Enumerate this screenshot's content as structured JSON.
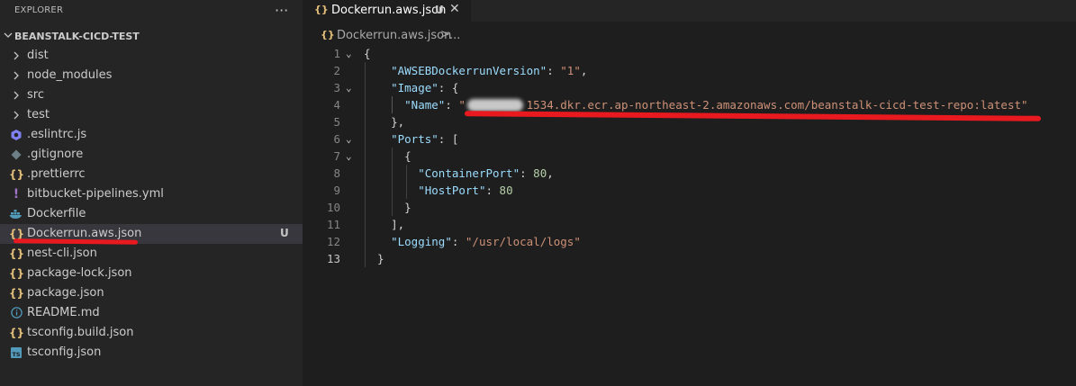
{
  "sidebar": {
    "title": "EXPLORER",
    "more": "···",
    "folder": "BEANSTALK-CICD-TEST",
    "items": [
      {
        "label": "dist",
        "type": "folder",
        "icon": "chevron-right-icon"
      },
      {
        "label": "node_modules",
        "type": "folder",
        "icon": "chevron-right-icon"
      },
      {
        "label": "src",
        "type": "folder",
        "icon": "chevron-right-icon"
      },
      {
        "label": "test",
        "type": "folder",
        "icon": "chevron-right-icon"
      },
      {
        "label": ".eslintrc.js",
        "type": "file",
        "icon": "eslint-icon"
      },
      {
        "label": ".gitignore",
        "type": "file",
        "icon": "git-icon"
      },
      {
        "label": ".prettierrc",
        "type": "file",
        "icon": "json-icon"
      },
      {
        "label": "bitbucket-pipelines.yml",
        "type": "file",
        "icon": "yaml-icon"
      },
      {
        "label": "Dockerfile",
        "type": "file",
        "icon": "docker-icon"
      },
      {
        "label": "Dockerrun.aws.json",
        "type": "file",
        "icon": "json-icon",
        "badge": "U"
      },
      {
        "label": "nest-cli.json",
        "type": "file",
        "icon": "json-icon"
      },
      {
        "label": "package-lock.json",
        "type": "file",
        "icon": "json-icon"
      },
      {
        "label": "package.json",
        "type": "file",
        "icon": "json-icon"
      },
      {
        "label": "README.md",
        "type": "file",
        "icon": "info-icon"
      },
      {
        "label": "tsconfig.build.json",
        "type": "file",
        "icon": "json-icon"
      },
      {
        "label": "tsconfig.json",
        "type": "file",
        "icon": "typescript-icon"
      }
    ]
  },
  "tab": {
    "icon": "{}",
    "label": "Dockerrun.aws.json",
    "status": "U",
    "close": "✕"
  },
  "breadcrumb": {
    "icon": "{}",
    "file": "Dockerrun.aws.json",
    "sep": ">",
    "more": "..."
  },
  "editor": {
    "lines": [
      "1",
      "2",
      "3",
      "4",
      "5",
      "6",
      "7",
      "8",
      "9",
      "10",
      "11",
      "12",
      "13"
    ],
    "active_line": "13",
    "code": {
      "k_version": "\"AWSEBDockerrunVersion\"",
      "v_version": "\"1\"",
      "k_image": "\"Image\"",
      "k_name": "\"Name\"",
      "v_name_visible": "1534.dkr.ecr.ap-northeast-2.amazonaws.com/beanstalk-cicd-test-repo:latest\"",
      "k_ports": "\"Ports\"",
      "k_container": "\"ContainerPort\"",
      "v_container": "80",
      "k_host": "\"HostPort\"",
      "v_host": "80",
      "k_logging": "\"Logging\"",
      "v_logging": "\"/usr/local/logs\""
    }
  },
  "colors": {
    "accent_mark": "#e8191f",
    "json_icon": "#e5c07b"
  }
}
